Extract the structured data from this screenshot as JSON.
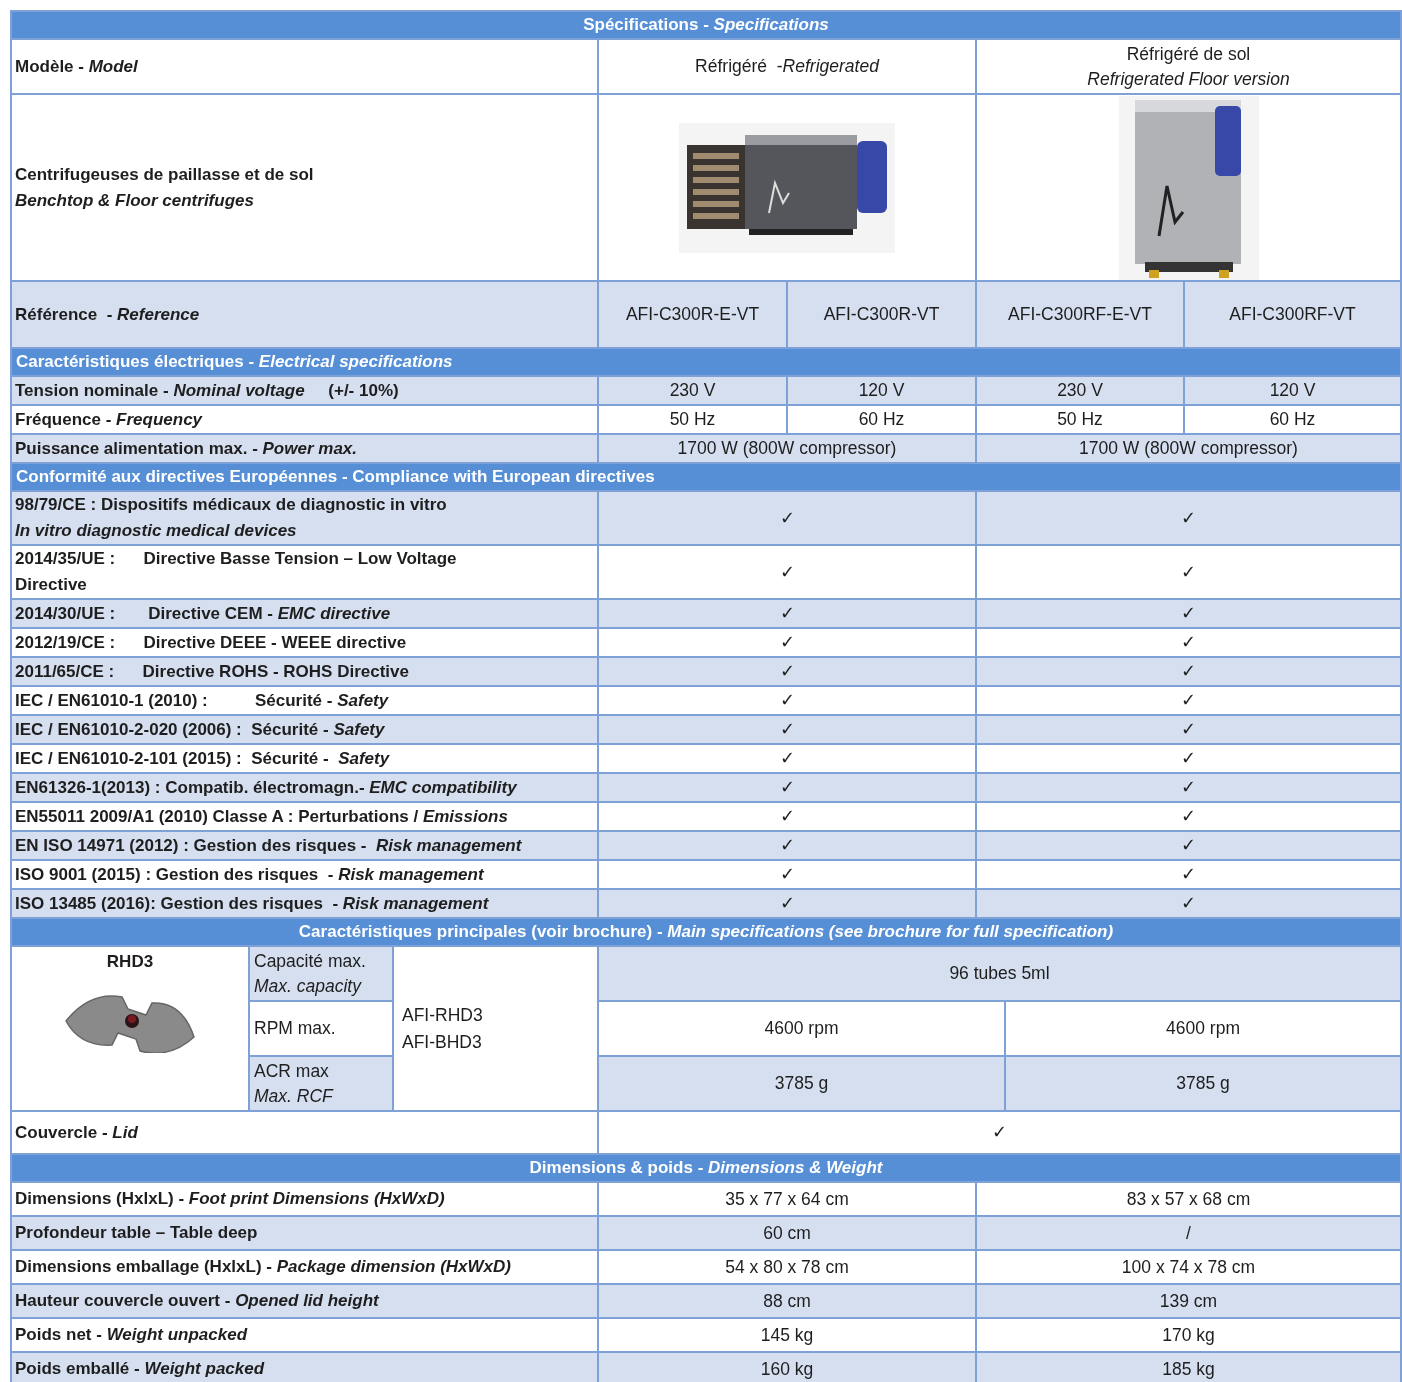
{
  "table": {
    "rows": [
      {
        "kind": "section",
        "text": "Spécifications - *Specifications*"
      },
      {
        "kind": "model",
        "shaded": false,
        "label": "Modèle - *Model*",
        "cells": [
          {
            "text": "Réfrigéré  -*Refrigerated*"
          },
          {
            "text": "Réfrigéré de sol\n*Refrigerated Floor version*"
          }
        ]
      },
      {
        "kind": "image",
        "shaded": false,
        "label": "Centrifugeuses de paillasse et de sol\n*Benchtop & Floor centrifuges*",
        "cells": [
          {
            "kind": "benchtop"
          },
          {
            "kind": "floor"
          }
        ]
      },
      {
        "kind": "reference",
        "shaded": true,
        "label": "Référence  - *Reference*",
        "cells": [
          {
            "text": "AFI-C300R-E-VT"
          },
          {
            "text": "AFI-C300R-VT"
          },
          {
            "text": "AFI-C300RF-E-VT"
          },
          {
            "text": "AFI-C300RF-VT"
          }
        ]
      },
      {
        "kind": "group",
        "text": "Caractéristiques électriques - *Electrical specifications*"
      },
      {
        "kind": "spec",
        "shaded": true,
        "label": "Tension nominale - *Nominal voltage*     (+/- 10%)",
        "cells": [
          {
            "text": "230 V"
          },
          {
            "text": "120 V"
          },
          {
            "text": "230 V"
          },
          {
            "text": "120 V"
          }
        ]
      },
      {
        "kind": "spec",
        "shaded": false,
        "label": "Fréquence - *Frequency*",
        "cells": [
          {
            "text": "50 Hz"
          },
          {
            "text": "60 Hz"
          },
          {
            "text": "50 Hz"
          },
          {
            "text": "60 Hz"
          }
        ]
      },
      {
        "kind": "spec",
        "shaded": true,
        "label": "Puissance alimentation max. - *Power max.*",
        "cells": [
          {
            "text": "1700 W (800W compressor)"
          },
          {
            "text": "1700 W (800W compressor)"
          }
        ]
      },
      {
        "kind": "group",
        "text": "Conformité aux directives Européennes - Compliance with European directives"
      },
      {
        "kind": "spec",
        "shaded": true,
        "label": "98/79/CE : Dispositifs médicaux de diagnostic in vitro\n*In vitro diagnostic medical devices*",
        "cells": [
          {
            "text": "✓"
          },
          {
            "text": "✓"
          }
        ]
      },
      {
        "kind": "spec",
        "shaded": false,
        "label": "2014/35/UE :      Directive Basse Tension – Low Voltage\nDirective",
        "cells": [
          {
            "text": "✓"
          },
          {
            "text": "✓"
          }
        ]
      },
      {
        "kind": "spec",
        "shaded": true,
        "label": "2014/30/UE :       Directive CEM - *EMC directive*",
        "cells": [
          {
            "text": "✓"
          },
          {
            "text": "✓"
          }
        ]
      },
      {
        "kind": "spec",
        "shaded": false,
        "label": "2012/19/CE :      Directive DEEE - WEEE directive",
        "cells": [
          {
            "text": "✓"
          },
          {
            "text": "✓"
          }
        ]
      },
      {
        "kind": "spec",
        "shaded": true,
        "label": "2011/65/CE :      Directive ROHS - ROHS Directive",
        "cells": [
          {
            "text": "✓"
          },
          {
            "text": "✓"
          }
        ]
      },
      {
        "kind": "spec",
        "shaded": false,
        "label": "IEC / EN61010-1 (2010) :          Sécurité - *Safety*",
        "cells": [
          {
            "text": "✓"
          },
          {
            "text": "✓"
          }
        ]
      },
      {
        "kind": "spec",
        "shaded": true,
        "label": "IEC / EN61010-2-020 (2006) :  Sécurité - *Safety*",
        "cells": [
          {
            "text": "✓"
          },
          {
            "text": "✓"
          }
        ]
      },
      {
        "kind": "spec",
        "shaded": false,
        "label": "IEC / EN61010-2-101 (2015) :  Sécurité -  *Safety*",
        "cells": [
          {
            "text": "✓"
          },
          {
            "text": "✓"
          }
        ]
      },
      {
        "kind": "spec",
        "shaded": true,
        "label": "EN61326-1(2013) : Compatib. électromagn.- *EMC compatibility*",
        "cells": [
          {
            "text": "✓"
          },
          {
            "text": "✓"
          }
        ]
      },
      {
        "kind": "spec",
        "shaded": false,
        "label": "EN55011 2009/A1 (2010) Classe A : Perturbations / *Emissions*",
        "cells": [
          {
            "text": "✓"
          },
          {
            "text": "✓"
          }
        ]
      },
      {
        "kind": "spec",
        "shaded": true,
        "label": "EN ISO 14971 (2012) : Gestion des risques -  *Risk management*",
        "cells": [
          {
            "text": "✓"
          },
          {
            "text": "✓"
          }
        ]
      },
      {
        "kind": "spec",
        "shaded": false,
        "label": "ISO 9001 (2015) : Gestion des risques  - *Risk management*",
        "cells": [
          {
            "text": "✓"
          },
          {
            "text": "✓"
          }
        ]
      },
      {
        "kind": "spec",
        "shaded": true,
        "label": "ISO 13485 (2016): Gestion des risques  - *Risk management*",
        "cells": [
          {
            "text": "✓"
          },
          {
            "text": "✓"
          }
        ]
      },
      {
        "kind": "section",
        "text": "Caractéristiques principales (voir brochure) - *Main specifications (see brochure for full specification)*"
      },
      {
        "kind": "rotor",
        "title": "RHD3",
        "models": "AFI-RHD3\nAFI-BHD3",
        "params": [
          {
            "shaded": true,
            "label": "Capacité max.\n*Max. capacity*",
            "cells": [
              {
                "text": "96 tubes 5ml"
              }
            ]
          },
          {
            "shaded": false,
            "label": "RPM max.",
            "cells": [
              {
                "text": "4600 rpm"
              },
              {
                "text": "4600 rpm"
              }
            ]
          },
          {
            "shaded": true,
            "label": "ACR max\n*Max. RCF*",
            "cells": [
              {
                "text": "3785 g"
              },
              {
                "text": "3785 g"
              }
            ]
          }
        ]
      },
      {
        "kind": "lid",
        "shaded": false,
        "label": "Couvercle - *Lid*",
        "cells": [
          {
            "text": "✓"
          }
        ]
      },
      {
        "kind": "section",
        "text": "Dimensions & poids - *Dimensions & Weight*"
      },
      {
        "kind": "dimension",
        "shaded": false,
        "label": "Dimensions (HxlxL) - *Foot print Dimensions (HxWxD)*",
        "cells": [
          {
            "text": "35 x 77 x 64 cm"
          },
          {
            "text": "83 x 57 x 68 cm"
          }
        ]
      },
      {
        "kind": "dimension",
        "shaded": true,
        "label": "Profondeur table – Table deep",
        "cells": [
          {
            "text": "60 cm"
          },
          {
            "text": "/"
          }
        ]
      },
      {
        "kind": "dimension",
        "shaded": false,
        "label": "Dimensions emballage (HxlxL) - *Package dimension (HxWxD)*",
        "cells": [
          {
            "text": "54 x 80 x 78 cm"
          },
          {
            "text": "100 x 74 x 78 cm"
          }
        ]
      },
      {
        "kind": "dimension",
        "shaded": true,
        "label": "Hauteur couvercle ouvert - *Opened lid height*",
        "cells": [
          {
            "text": "88 cm"
          },
          {
            "text": "139 cm"
          }
        ]
      },
      {
        "kind": "dimension",
        "shaded": false,
        "label": "Poids net - *Weight unpacked*",
        "cells": [
          {
            "text": "145 kg"
          },
          {
            "text": "170 kg"
          }
        ]
      },
      {
        "kind": "dimension",
        "shaded": true,
        "label": "Poids emballé - *Weight packed*",
        "cells": [
          {
            "text": "160 kg"
          },
          {
            "text": "185 kg"
          }
        ]
      }
    ]
  }
}
